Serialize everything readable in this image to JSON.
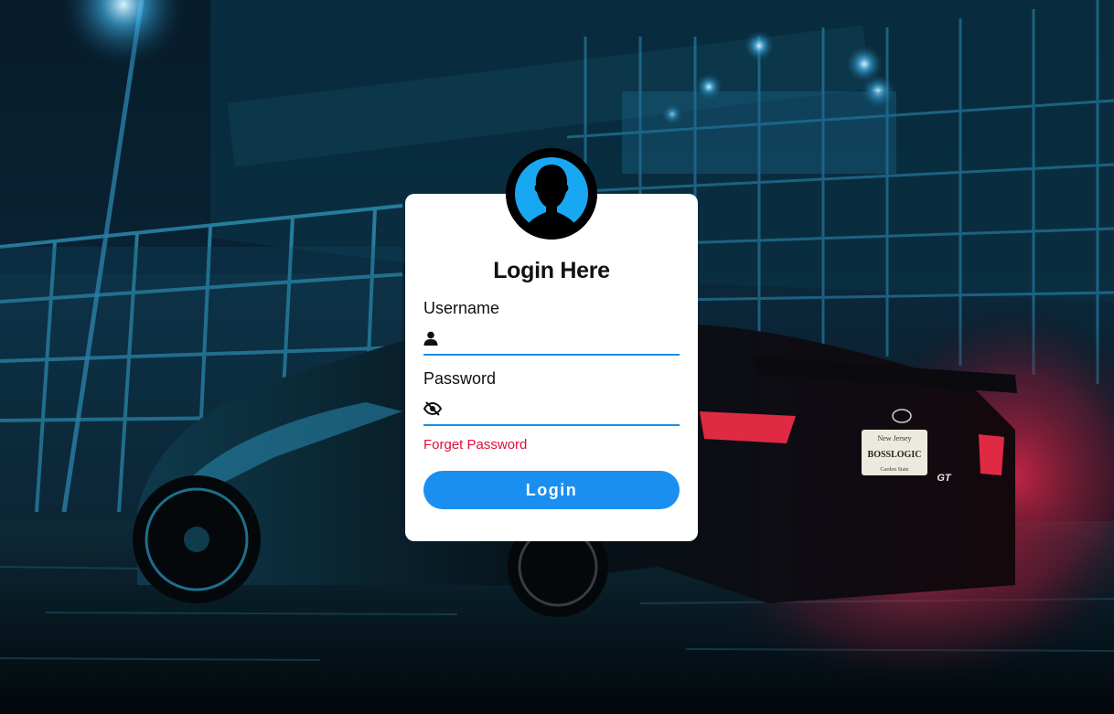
{
  "login": {
    "title": "Login Here",
    "username_label": "Username",
    "username_value": "",
    "password_label": "Password",
    "password_value": "",
    "forgot_label": "Forget Password",
    "submit_label": "Login"
  },
  "background": {
    "plate_line1": "New Jersey",
    "plate_line2": "BOSSLOGIC",
    "plate_line3": "Garden State",
    "badge": "GT"
  },
  "colors": {
    "accent": "#1a8fef",
    "link": "#e0103a",
    "card": "#ffffff",
    "avatar_ring": "#18a8f2"
  },
  "icons": {
    "username": "user-icon",
    "password": "eye-slash-icon",
    "avatar": "person-silhouette-icon"
  }
}
